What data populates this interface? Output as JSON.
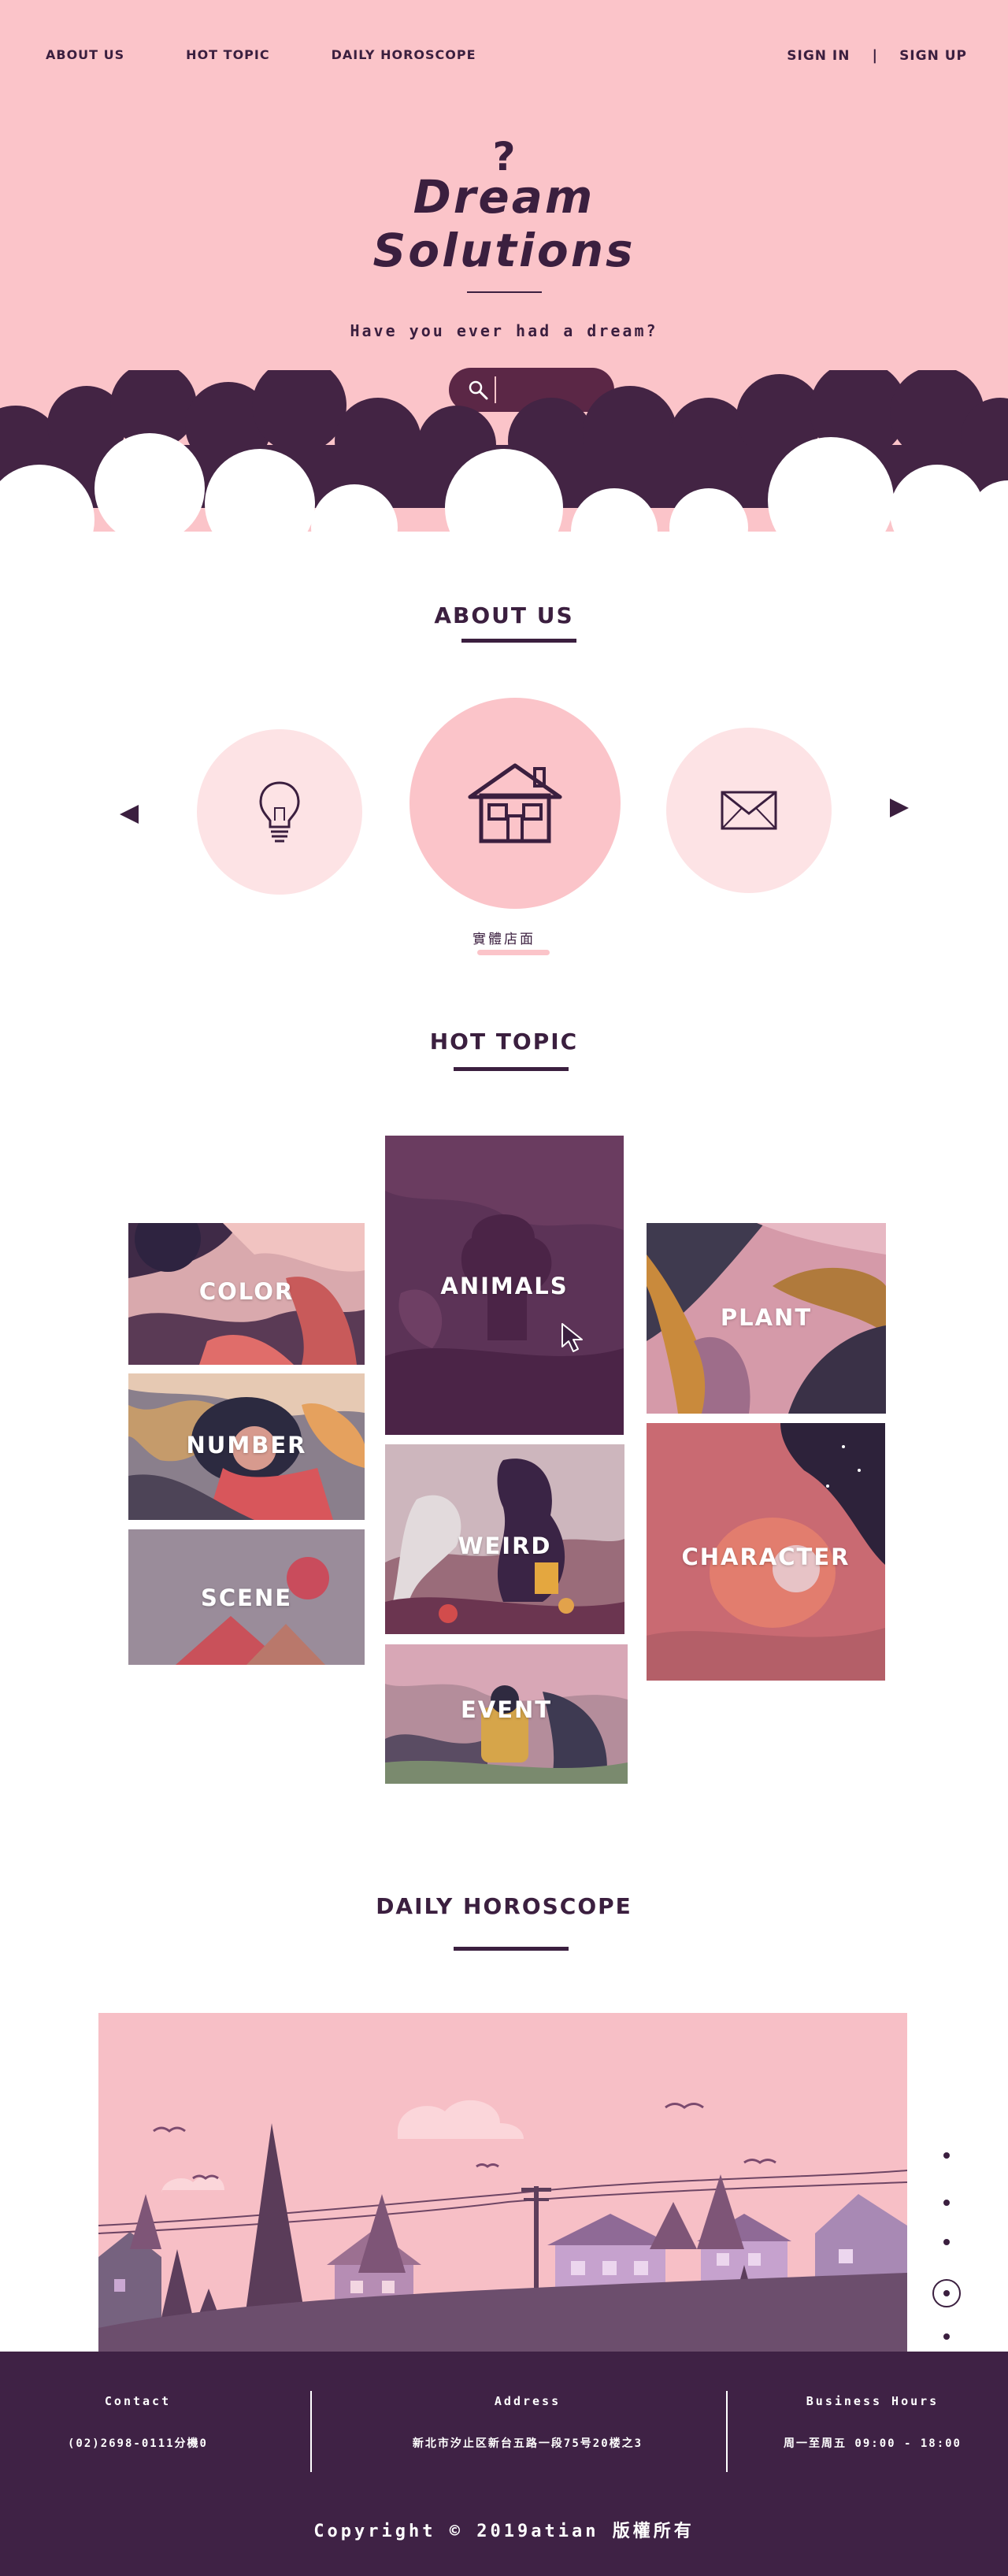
{
  "nav": {
    "about": "ABOUT US",
    "hot": "HOT TOPIC",
    "horoscope": "DAILY HOROSCOPE",
    "signin": "SIGN IN",
    "separator": "|",
    "signup": "SIGN UP"
  },
  "hero": {
    "question_mark": "?",
    "brand_line1": "Dream",
    "brand_line2": "Solutions",
    "tagline": "Have you ever had a dream?",
    "search_placeholder": ""
  },
  "about": {
    "title": "ABOUT US",
    "items": [
      {
        "icon": "lightbulb-icon"
      },
      {
        "icon": "house-icon"
      },
      {
        "icon": "envelope-icon"
      }
    ],
    "active_caption": "實體店面"
  },
  "hot_topic": {
    "title": "HOT TOPIC",
    "tiles": {
      "color": "COLOR",
      "number": "NUMBER",
      "scene": "SCENE",
      "animals": "ANIMALS",
      "weird": "WEIRD",
      "event": "EVENT",
      "plant": "PLANT",
      "character": "CHARACTER"
    }
  },
  "horoscope": {
    "title": "DAILY HOROSCOPE",
    "slides": 5,
    "active_slide": 4
  },
  "footer": {
    "contact_label": "Contact",
    "contact_value": "(02)2698-0111分機0",
    "address_label": "Address",
    "address_value": "新北市汐止区新台五路一段75号20楼之3",
    "hours_label": "Business Hours",
    "hours_value": "周一至周五 09:00 - 18:00",
    "copyright": "Copyright © 2019atian 版權所有"
  },
  "colors": {
    "pink": "#fbc4c9",
    "plum": "#3b1f3f",
    "footer": "#3f2245"
  }
}
